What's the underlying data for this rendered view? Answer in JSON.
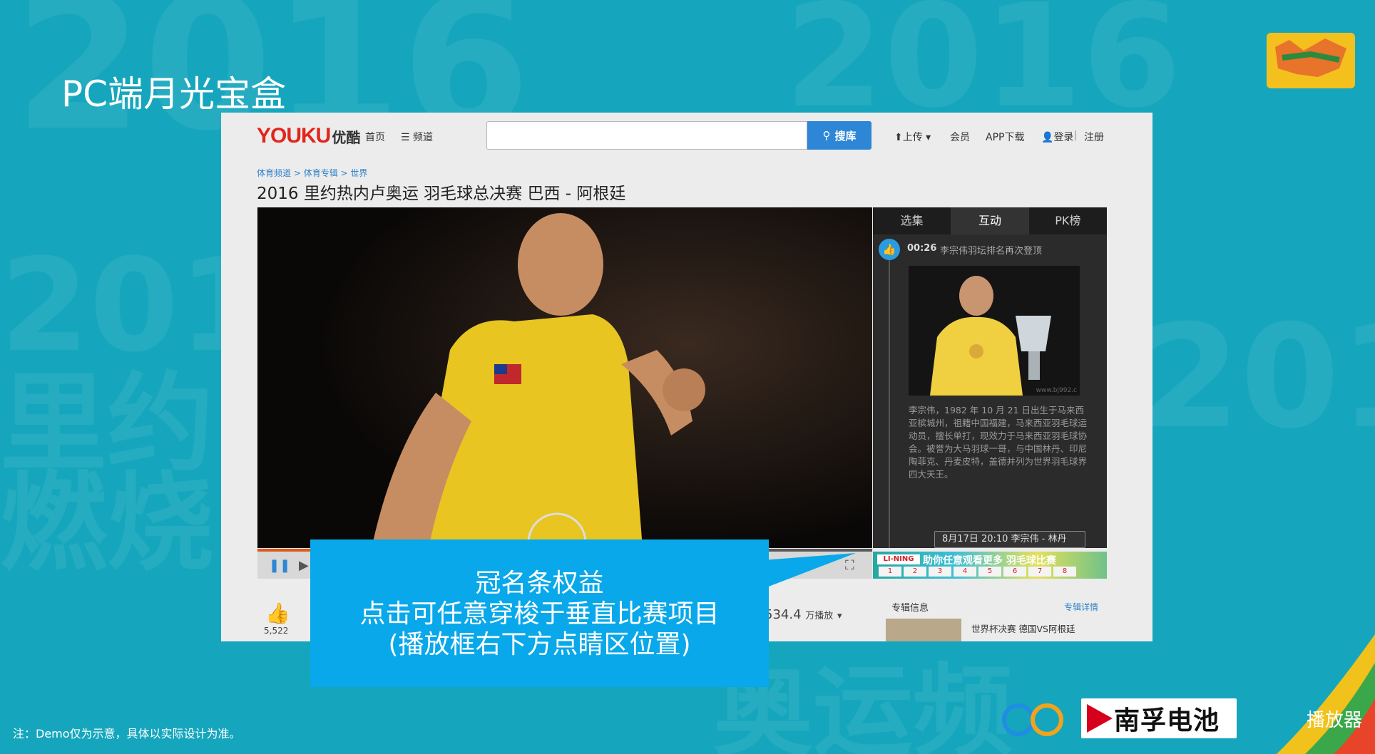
{
  "slide": {
    "title": "PC端月光宝盒",
    "note": "注：Demo仅为示意，具体以实际设计为准。",
    "section_label": "播放器",
    "sponsor": "南孚电池"
  },
  "youku": {
    "logo_youku": "YOUKU",
    "logo_cn": "优酷",
    "nav_home": "首页",
    "nav_channel": "频道",
    "search_placeholder": "",
    "search_button": "搜库",
    "upload": "上传",
    "member": "会员",
    "app_download": "APP下载",
    "login": "登录",
    "register": "注册",
    "breadcrumb": [
      "体育频道",
      "体育专辑",
      "世界"
    ],
    "video_title": "2016 里约热内卢奥运 羽毛球总决赛  巴西 - 阿根廷"
  },
  "side_panel": {
    "tabs": [
      "选集",
      "互动",
      "PK榜"
    ],
    "active_tab": 1,
    "event_time": "00:26",
    "event_text": "李宗伟羽坛排名再次登顶",
    "photo_watermark": "www.bj992.c",
    "event_desc": "李宗伟，1982 年 10 月 21 日出生于马来西亚槟城州，祖籍中国福建，马来西亚羽毛球运动员，擅长单打，现效力于马来西亚羽毛球协会。被誉为大马羽球一哥，与中国林丹、印尼陶菲克、丹麦皮特，盖德并列为世界羽毛球界四大天王。",
    "event_chip": "8月17日 20:10  李宗伟 - 林丹"
  },
  "ad_bar": {
    "brand": "LI-NING",
    "slogan": "助你任意观看更多 羽毛球比赛",
    "numbers": [
      "1",
      "2",
      "3",
      "4",
      "5",
      "6",
      "7",
      "8"
    ]
  },
  "below_player": {
    "like_count": "5,522",
    "play_count": "534.4",
    "play_unit": "万播放",
    "album_title": "专辑信息",
    "album_more": "专辑详情",
    "album_item": "世界杯决赛 德国VS阿根廷"
  },
  "callout": {
    "line1": "冠名条权益",
    "line2": "点击可任意穿梭于垂直比赛项目",
    "line3": "(播放框右下方点睛区位置)"
  },
  "colors": {
    "background": "#15a6bd",
    "callout": "#08a8ea",
    "search_button": "#2d86d6",
    "youku_red": "#e1261c",
    "youku_blue": "#1d8fd6"
  }
}
